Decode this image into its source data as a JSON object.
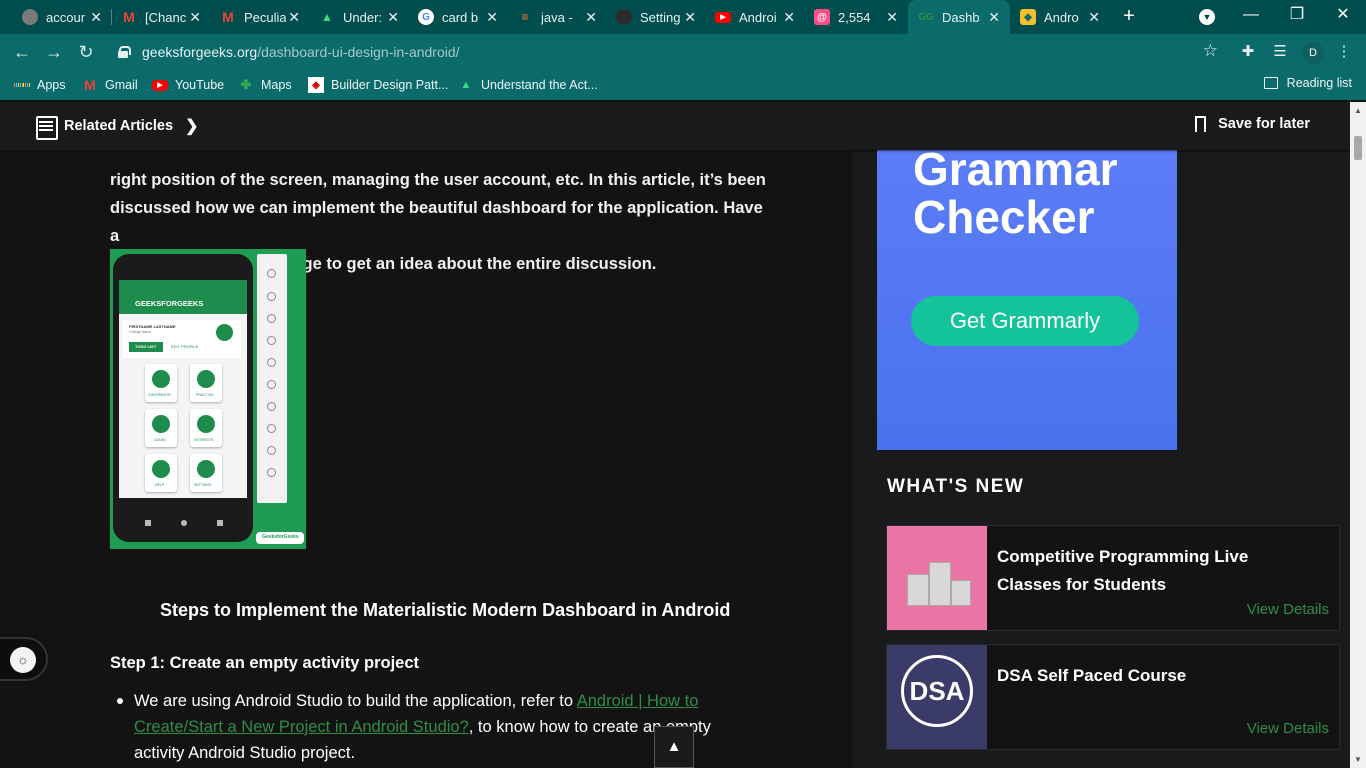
{
  "browser": {
    "tabs": [
      {
        "title": "accour",
        "icon": "globe-icon",
        "color": "#7a7a7a"
      },
      {
        "title": "[Chanc",
        "icon": "gmail-icon",
        "color": "#ffffff"
      },
      {
        "title": "Peculia",
        "icon": "gmail-icon",
        "color": "#ffffff"
      },
      {
        "title": "Under:",
        "icon": "android-icon",
        "color": "#3ddc84"
      },
      {
        "title": "card b",
        "icon": "google-icon",
        "color": "#ffffff"
      },
      {
        "title": "java -",
        "icon": "stackoverflow-icon",
        "color": "#f48024"
      },
      {
        "title": "Setting",
        "icon": "github-icon",
        "color": "#2b2b2b"
      },
      {
        "title": "Androi",
        "icon": "youtube-icon",
        "color": "#ff0000"
      },
      {
        "title": "2,554",
        "icon": "notification-icon",
        "color": "#ff4f8b"
      },
      {
        "title": "Dashb",
        "icon": "gfg-icon",
        "color": "#2f8d46"
      },
      {
        "title": "Andro",
        "icon": "android-icon",
        "color": "#f7c02b"
      }
    ],
    "url_host": "geeksforgeeks.org",
    "url_path": "/dashboard-ui-design-in-android/",
    "profile_initial": "D",
    "bookmarks": [
      {
        "label": "Apps",
        "icon": "apps-grid-icon"
      },
      {
        "label": "Gmail",
        "icon": "gmail-icon"
      },
      {
        "label": "YouTube",
        "icon": "youtube-icon"
      },
      {
        "label": "Maps",
        "icon": "maps-icon"
      },
      {
        "label": "Builder Design Patt...",
        "icon": "bookmark-page-icon"
      },
      {
        "label": "Understand the Act...",
        "icon": "android-icon"
      }
    ],
    "reading_list": "Reading list"
  },
  "page": {
    "related": "Related Articles",
    "save": "Save for later",
    "paragraph_cut": "right position of the screen, managing the user account, etc.",
    "paragraph_line1": "right position of the screen, managing the user account, etc. In this article, it’s been",
    "paragraph_line2": "discussed how we can implement the beautiful dashboard for the application. Have a",
    "paragraph_line3": "look at the following image to get an idea about the entire discussion.",
    "phone": {
      "app_title": "GEEKSFORGEEKS",
      "user": "FIRSTNAME LASTNAME",
      "college": "College Name",
      "todo": "TODO LIST",
      "edit": "EDIT PROFILE",
      "tiles": [
        "CONTRIBUTE",
        "PRACTICE",
        "LEARN",
        "INTERESTS",
        "HELP",
        "SETTINGS"
      ],
      "logo": "GeeksforGeeks"
    },
    "heading": "Steps to Implement the Materialistic Modern Dashboard in Android",
    "step1": "Step 1: Create an empty activity project",
    "bullet_prefix": "We are using Android Studio to build the application, refer to ",
    "bullet_link": "Android | How to Create/Start a New Project in Android Studio?",
    "bullet_suffix": ", to know how to create an empty activity Android Studio project.",
    "ad_title": "Grammar Checker",
    "ad_button": "Get Grammarly",
    "whats_new": "WHAT'S NEW",
    "cards": [
      {
        "title": "Competitive Programming Live Classes for Students",
        "link": "View Details"
      },
      {
        "title": "DSA Self Paced Course",
        "link": "View Details"
      }
    ],
    "dsa_badge": "DSA"
  }
}
